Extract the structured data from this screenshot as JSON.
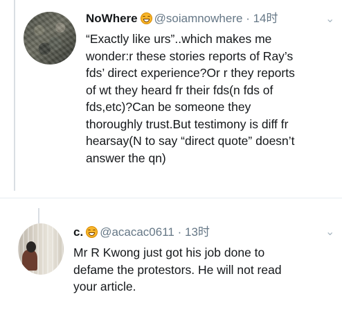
{
  "tweets": [
    {
      "name": "NoWhere",
      "handle": "@soiamnowhere",
      "separator": "·",
      "time": "14时",
      "text_lines": [
        "“Exactly like urs”..which makes me",
        "wonder:r these stories reports of Ray’s",
        "fds’ direct experience?Or r they reports",
        "of wt they heard fr their fds(n fds of",
        "fds,etc)?Can be someone they",
        "thoroughly trust.But testimony is diff fr",
        "hearsay(N to say “direct quote” doesn’t",
        "answer the qn)"
      ],
      "emoji": "grinning-face-emoji",
      "menu_icon": "chevron-down-icon"
    },
    {
      "name": "c.",
      "handle": "@acacac0611",
      "separator": "·",
      "time": "13时",
      "text_lines": [
        "Mr R Kwong just got his job done to",
        "defame the protestors. He will not read",
        "your article."
      ],
      "emoji": "grinning-face-emoji",
      "menu_icon": "chevron-down-icon"
    }
  ],
  "colors": {
    "text": "#14171a",
    "secondary_text": "#657786",
    "thread_line": "#d9dee3",
    "divider": "#e6ecf0"
  }
}
